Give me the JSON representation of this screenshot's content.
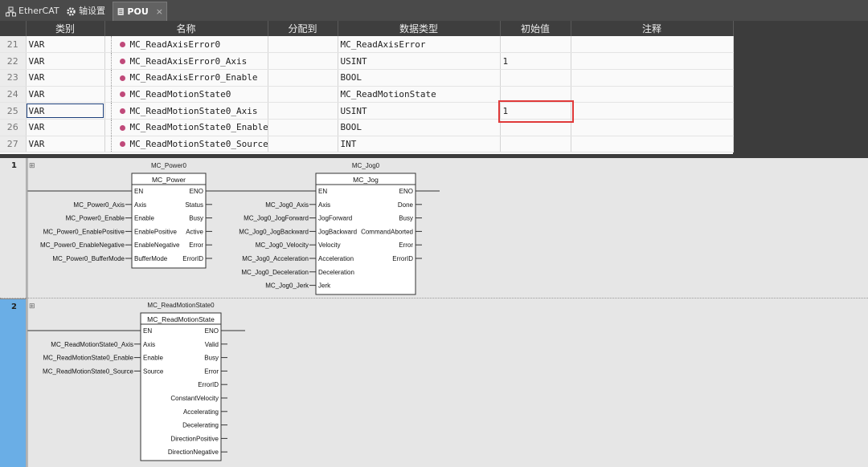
{
  "tabs": [
    {
      "label": "EtherCAT",
      "icon": "network-icon"
    },
    {
      "label": "轴设置",
      "icon": "gear-icon"
    },
    {
      "label": "POU",
      "icon": "document-icon",
      "active": true
    }
  ],
  "table": {
    "columns": [
      "类别",
      "名称",
      "分配到",
      "数据类型",
      "初始值",
      "注释"
    ],
    "rows": [
      {
        "num": "21",
        "kind": "VAR",
        "name": "MC_ReadAxisError0",
        "assign": "",
        "type": "MC_ReadAxisError",
        "init": "",
        "comment": ""
      },
      {
        "num": "22",
        "kind": "VAR",
        "name": "MC_ReadAxisError0_Axis",
        "assign": "",
        "type": "USINT",
        "init": "1",
        "comment": ""
      },
      {
        "num": "23",
        "kind": "VAR",
        "name": "MC_ReadAxisError0_Enable",
        "assign": "",
        "type": "BOOL",
        "init": "",
        "comment": ""
      },
      {
        "num": "24",
        "kind": "VAR",
        "name": "MC_ReadMotionState0",
        "assign": "",
        "type": "MC_ReadMotionState",
        "init": "",
        "comment": ""
      },
      {
        "num": "25",
        "kind": "VAR",
        "name": "MC_ReadMotionState0_Axis",
        "assign": "",
        "type": "USINT",
        "init": "1",
        "comment": ""
      },
      {
        "num": "26",
        "kind": "VAR",
        "name": "MC_ReadMotionState0_Enable",
        "assign": "",
        "type": "BOOL",
        "init": "",
        "comment": ""
      },
      {
        "num": "27",
        "kind": "VAR",
        "name": "MC_ReadMotionState0_Source",
        "assign": "",
        "type": "INT",
        "init": "",
        "comment": ""
      }
    ]
  },
  "rungs": [
    {
      "num": "1",
      "blocks": [
        {
          "instance": "MC_Power0",
          "type": "MC_Power",
          "inputs": [
            {
              "pin": "EN",
              "var": ""
            },
            {
              "pin": "Axis",
              "var": "MC_Power0_Axis"
            },
            {
              "pin": "Enable",
              "var": "MC_Power0_Enable"
            },
            {
              "pin": "EnablePositive",
              "var": "MC_Power0_EnablePositive"
            },
            {
              "pin": "EnableNegative",
              "var": "MC_Power0_EnableNegative"
            },
            {
              "pin": "BufferMode",
              "var": "MC_Power0_BufferMode"
            }
          ],
          "outputs": [
            "ENO",
            "Status",
            "Busy",
            "Active",
            "Error",
            "ErrorID"
          ]
        },
        {
          "instance": "MC_Jog0",
          "type": "MC_Jog",
          "inputs": [
            {
              "pin": "EN",
              "var": ""
            },
            {
              "pin": "Axis",
              "var": "MC_Jog0_Axis"
            },
            {
              "pin": "JogForward",
              "var": "MC_Jog0_JogForward"
            },
            {
              "pin": "JogBackward",
              "var": "MC_Jog0_JogBackward"
            },
            {
              "pin": "Velocity",
              "var": "MC_Jog0_Velocity"
            },
            {
              "pin": "Acceleration",
              "var": "MC_Jog0_Acceleration"
            },
            {
              "pin": "Deceleration",
              "var": "MC_Jog0_Deceleration"
            },
            {
              "pin": "Jerk",
              "var": "MC_Jog0_Jerk"
            }
          ],
          "outputs": [
            "ENO",
            "Done",
            "Busy",
            "CommandAborted",
            "Error",
            "ErrorID"
          ]
        }
      ]
    },
    {
      "num": "2",
      "blocks": [
        {
          "instance": "MC_ReadMotionState0",
          "type": "MC_ReadMotionState",
          "inputs": [
            {
              "pin": "EN",
              "var": ""
            },
            {
              "pin": "Axis",
              "var": "MC_ReadMotionState0_Axis"
            },
            {
              "pin": "Enable",
              "var": "MC_ReadMotionState0_Enable"
            },
            {
              "pin": "Source",
              "var": "MC_ReadMotionState0_Source"
            }
          ],
          "outputs": [
            "ENO",
            "Valid",
            "Busy",
            "Error",
            "ErrorID",
            "ConstantVelocity",
            "Accelerating",
            "Decelerating",
            "DirectionPositive",
            "DirectionNegative"
          ]
        }
      ]
    }
  ],
  "expand_symbol": "⊞",
  "colors": {
    "highlight": "#e03a3a",
    "selected_rung": "#6aaee6",
    "tab_bg": "#4a4a4a"
  }
}
